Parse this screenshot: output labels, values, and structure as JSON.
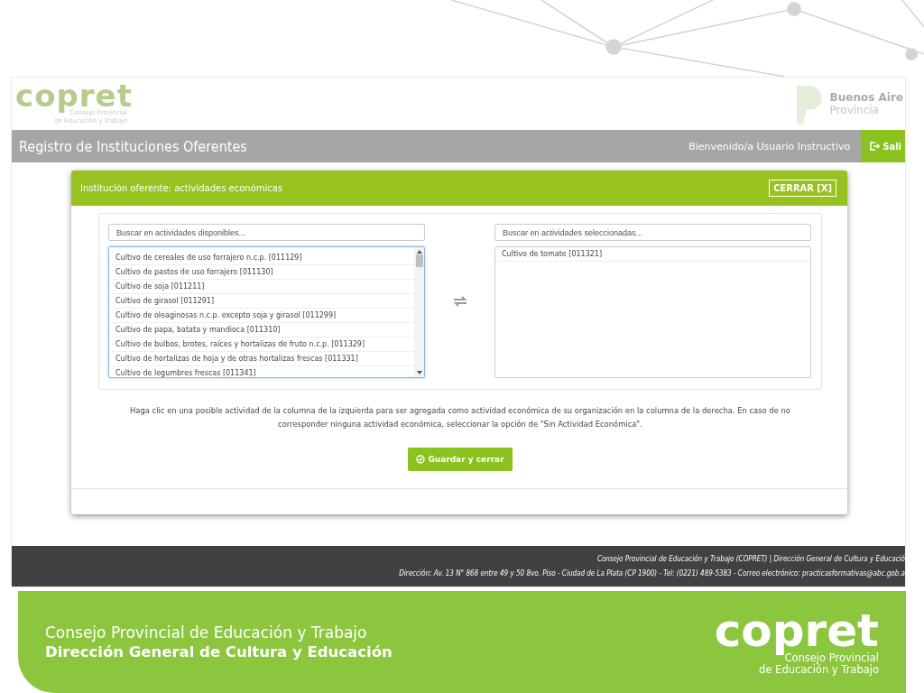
{
  "header": {
    "logo": {
      "wordmark": "copret",
      "subtitle": [
        "Consejo Provincial",
        "de Educación y Trabajo"
      ]
    },
    "province_logo": {
      "name": "Buenos Aire",
      "subtitle": "Provincia"
    }
  },
  "navbar": {
    "title": "Registro de Instituciones Oferentes",
    "welcome": "Bienvenido/a Usuario Instructivo",
    "logout_label": "Sali"
  },
  "modal": {
    "title": "Institución oferente: actividades económicas",
    "close_label": "CERRAR [X]",
    "available": {
      "placeholder": "Buscar en actividades disponibles...",
      "items": [
        "Cultivo de cereales de uso forrajero n.c.p. [011129]",
        "Cultivo de pastos de uso forrajero [011130]",
        "Cultivo de soja [011211]",
        "Cultivo de girasol [011291]",
        "Cultivo de oleaginosas n.c.p. excepto soja y girasol [011299]",
        "Cultivo de papa, batata y mandioca [011310]",
        "Cultivo de bulbos, brotes, raíces y hortalizas de fruto n.c.p. [011329]",
        "Cultivo de hortalizas de hoja y de otras hortalizas frescas [011331]",
        "Cultivo de legumbres frescas [011341]"
      ]
    },
    "selected": {
      "placeholder": "Buscar en actividades seleccionadas...",
      "items": [
        "Cultivo de tomate [011321]"
      ]
    },
    "hint": "Haga clic en una posible actividad de la columna de la izquierda para ser agregada como actividad económica de su organización en la columna de la derecha. En caso de no corresponder ninguna actividad económica, seleccionar la opción de \"Sin Actividad Económica\".",
    "save_button": "Guardar y cerrar"
  },
  "footer": {
    "lines": [
      "Consejo Provincial de Educación y Trabajo (COPRET) | Dirección General de Cultura y Educació",
      "Dirección: Av. 13 N° 868 entre 49 y 50 8vo. Piso - Ciudad de La Plata (CP 1900) - Tel: (0221) 489-5383 - Correo electrónico: practicasformativas@abc.gob.a"
    ]
  },
  "banner": {
    "lines": [
      "Consejo Provincial de Educación y Trabajo",
      "Dirección General de Cultura y Educación"
    ],
    "logo": {
      "wordmark": "copret",
      "subtitle": [
        "Consejo Provincial",
        "de Educación y Trabajo"
      ]
    }
  }
}
